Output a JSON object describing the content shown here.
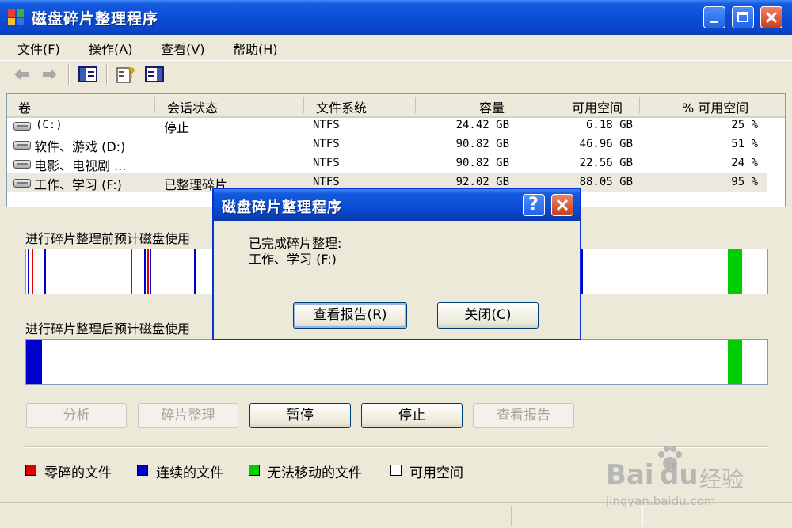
{
  "window": {
    "title": "磁盘碎片整理程序",
    "app_icon": "defrag-app-icon"
  },
  "menu": [
    {
      "label": "文件(F)"
    },
    {
      "label": "操作(A)"
    },
    {
      "label": "查看(V)"
    },
    {
      "label": "帮助(H)"
    }
  ],
  "toolbar": {
    "icons": [
      "back-arrow-icon",
      "forward-arrow-icon",
      "show-hide-console-tree-icon",
      "help-icon",
      "properties-pane-icon"
    ]
  },
  "volume_list": {
    "columns": [
      "卷",
      "会话状态",
      "文件系统",
      "容量",
      "可用空间",
      "% 可用空间"
    ],
    "rows": [
      {
        "volume": "(C:)",
        "status": "停止",
        "fs": "NTFS",
        "capacity": "24.42 GB",
        "free": "6.18 GB",
        "pct": "25 %"
      },
      {
        "volume": "软件、游戏 (D:)",
        "status": "",
        "fs": "NTFS",
        "capacity": "90.82 GB",
        "free": "46.96 GB",
        "pct": "51 %"
      },
      {
        "volume": "电影、电视剧 ...",
        "status": "",
        "fs": "NTFS",
        "capacity": "90.82 GB",
        "free": "22.56 GB",
        "pct": "24 %"
      },
      {
        "volume": "工作、学习 (F:)",
        "status": "已整理碎片",
        "fs": "NTFS",
        "capacity": "92.02 GB",
        "free": "88.05 GB",
        "pct": "95 %"
      }
    ]
  },
  "before_label": "进行碎片整理前预计磁盘使用",
  "after_label": "进行碎片整理后预计磁盘使用",
  "buttons": {
    "analyze": "分析",
    "defrag": "碎片整理",
    "pause": "暂停",
    "stop": "停止",
    "view_report": "查看报告"
  },
  "legend": [
    {
      "label": "零碎的文件",
      "color": "#e00000"
    },
    {
      "label": "连续的文件",
      "color": "#0000cc"
    },
    {
      "label": "无法移动的文件",
      "color": "#00cc00"
    },
    {
      "label": "可用空间",
      "color": "#ffffff"
    }
  ],
  "dialog": {
    "title": "磁盘碎片整理程序",
    "line1": "已完成碎片整理:",
    "line2": "工作、学习 (F:)",
    "view_report": "查看报告(R)",
    "close": "关闭(C)"
  },
  "watermark": {
    "brand": "Bai",
    "brand2": "du",
    "suffix": "经验",
    "url": "jingyan.baidu.com"
  }
}
